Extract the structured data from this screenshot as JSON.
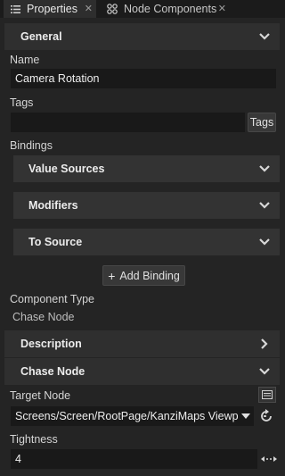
{
  "tabs": {
    "properties": {
      "label": "Properties",
      "icon": "list-icon"
    },
    "node_components": {
      "label": "Node Components",
      "icon": "components-icon"
    }
  },
  "general": {
    "title": "General",
    "name_label": "Name",
    "name_value": "Camera Rotation",
    "tags_label": "Tags",
    "tags_value": "",
    "tags_button": "Tags"
  },
  "bindings": {
    "label": "Bindings",
    "value_sources": "Value Sources",
    "modifiers": "Modifiers",
    "to_source": "To Source",
    "add_binding": "Add Binding"
  },
  "component": {
    "type_label": "Component Type",
    "type_value": "Chase Node"
  },
  "description": {
    "title": "Description"
  },
  "chase_node": {
    "title": "Chase Node",
    "target_label": "Target Node",
    "target_value": "Screens/Screen/RootPage/KanziMaps Viewpo",
    "tightness_label": "Tightness",
    "tightness_value": "4"
  },
  "colors": {
    "background": "#242424",
    "section": "#2f2f2f",
    "field": "#191919",
    "text": "#d2d2d2"
  }
}
